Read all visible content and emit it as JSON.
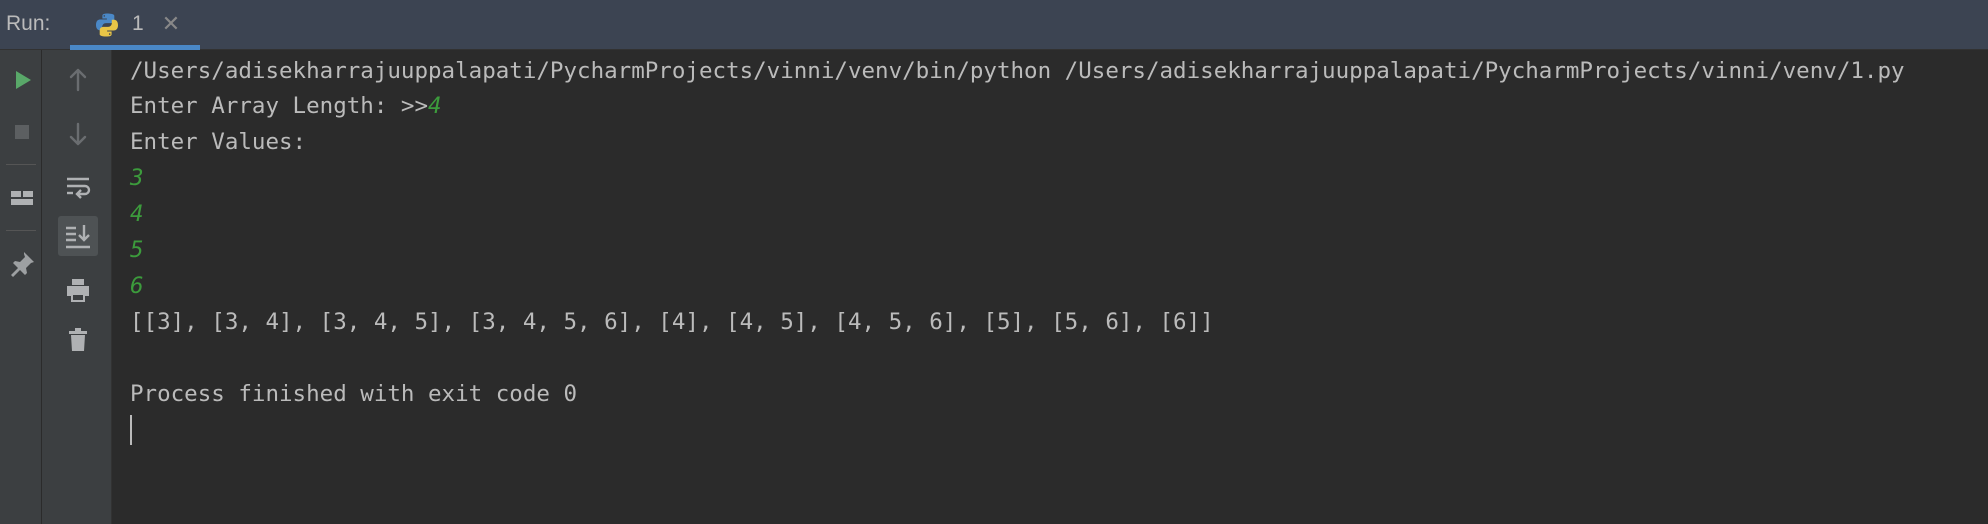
{
  "run_panel": {
    "label": "Run:",
    "tab": {
      "label": "1",
      "close": "✕"
    }
  },
  "toolbar_left": [
    {
      "name": "rerun-icon"
    },
    {
      "name": "stop-icon"
    },
    {
      "name": "layout-icon"
    },
    {
      "name": "pin-icon"
    }
  ],
  "toolbar_right": [
    {
      "name": "arrow-up-icon"
    },
    {
      "name": "arrow-down-icon"
    },
    {
      "name": "soft-wrap-icon"
    },
    {
      "name": "scroll-to-end-icon"
    },
    {
      "name": "print-icon"
    },
    {
      "name": "trash-icon"
    }
  ],
  "colors": {
    "console_bg": "#2b2b2b",
    "toolbar_bg": "#3c3f41",
    "tabbar_bg": "#3c4452",
    "text": "#bbbbbb",
    "input_text": "#3c9b3c",
    "tab_accent": "#4a88c7",
    "run_green": "#59a869"
  },
  "console": {
    "command": "/Users/adisekharrajuuppalapati/PycharmProjects/vinni/venv/bin/python /Users/adisekharrajuuppalapati/PycharmProjects/vinni/venv/1.py",
    "prompt_length": "Enter Array Length: >>",
    "input_length": "4",
    "prompt_values": "Enter Values:",
    "inputs": [
      "3",
      "4",
      "5",
      "6"
    ],
    "output": "[[3], [3, 4], [3, 4, 5], [3, 4, 5, 6], [4], [4, 5], [4, 5, 6], [5], [5, 6], [6]]",
    "finish": "Process finished with exit code 0"
  }
}
